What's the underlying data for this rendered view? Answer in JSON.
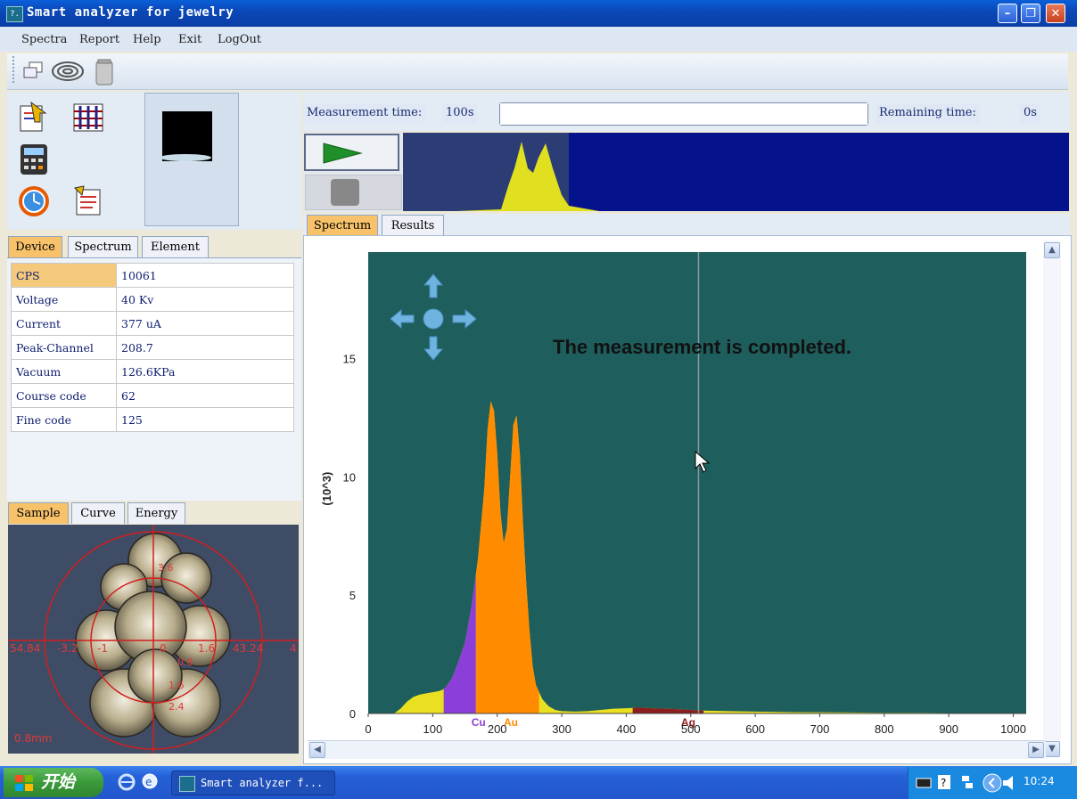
{
  "window": {
    "title": "Smart analyzer for jewelry",
    "icon_text": "?.",
    "controls": [
      "minimize",
      "restore",
      "close"
    ]
  },
  "menu": {
    "items": [
      "Spectra",
      "Report",
      "Help",
      "Exit",
      "LogOut"
    ]
  },
  "toolbar": {
    "icons": [
      "windows-icon",
      "rings-icon",
      "container-icon"
    ]
  },
  "left_icons": [
    "report-doc-icon",
    "grid-chart-icon",
    "calculator-icon",
    "clock-icon",
    "notes-icon"
  ],
  "device_tabs": {
    "labels": [
      "Device",
      "Spectrum",
      "Element"
    ],
    "active": "Device"
  },
  "device_table": [
    {
      "key": "CPS",
      "value": "10061"
    },
    {
      "key": "Voltage",
      "value": "40 Kv"
    },
    {
      "key": "Current",
      "value": "377 uA"
    },
    {
      "key": "Peak-Channel",
      "value": "208.7"
    },
    {
      "key": "Vacuum",
      "value": "126.6KPa"
    },
    {
      "key": "Course code",
      "value": "62"
    },
    {
      "key": "Fine code",
      "value": "125"
    }
  ],
  "sample_tabs": {
    "labels": [
      "Sample",
      "Curve",
      "Energy"
    ],
    "active": "Sample"
  },
  "sample": {
    "scale_label": "0.8mm",
    "axis_labels_h": [
      "54.84",
      "-3.2",
      "-1",
      "0",
      "1.6",
      "43.24",
      "4"
    ],
    "axis_labels_v": [
      "3.6",
      "0.8",
      "1.6",
      "2.4"
    ]
  },
  "measurement": {
    "time_label": "Measurement time:",
    "time_value": "100s",
    "progress": 1.0,
    "remaining_label": "Remaining time:",
    "remaining_value": "0s"
  },
  "chart_tabs": {
    "labels": [
      "Spectrum",
      "Results"
    ],
    "active": "Spectrum"
  },
  "status_message": "The measurement is completed.",
  "chart_data": {
    "type": "area",
    "ylabel": "(10^3)",
    "xlim": [
      0,
      1020
    ],
    "ylim": [
      0,
      19.5
    ],
    "x_ticks": [
      0,
      100,
      200,
      300,
      400,
      500,
      600,
      700,
      800,
      900,
      1000
    ],
    "y_ticks": [
      0,
      5,
      10,
      15
    ],
    "cursor_x": 512,
    "background": "#1e5e5c",
    "x": [
      40,
      50,
      60,
      70,
      80,
      90,
      100,
      110,
      115,
      120,
      130,
      140,
      150,
      160,
      165,
      170,
      180,
      185,
      190,
      195,
      200,
      205,
      210,
      215,
      220,
      225,
      230,
      235,
      240,
      245,
      250,
      255,
      260,
      270,
      280,
      290,
      300,
      320,
      340,
      360,
      380,
      400,
      420,
      440,
      460,
      480,
      500,
      520,
      560,
      600,
      650,
      700,
      750,
      800,
      850,
      900,
      950,
      1000
    ],
    "y": [
      0.0,
      0.2,
      0.5,
      0.7,
      0.8,
      0.85,
      0.9,
      0.95,
      1.0,
      1.1,
      1.5,
      2.2,
      3.0,
      4.5,
      5.5,
      6.5,
      9.5,
      12.0,
      13.2,
      12.8,
      11.0,
      8.5,
      7.2,
      7.8,
      10.0,
      12.2,
      12.6,
      11.0,
      8.0,
      5.5,
      3.5,
      2.0,
      1.2,
      0.6,
      0.3,
      0.15,
      0.1,
      0.08,
      0.1,
      0.15,
      0.2,
      0.22,
      0.25,
      0.22,
      0.2,
      0.18,
      0.15,
      0.12,
      0.1,
      0.08,
      0.06,
      0.05,
      0.04,
      0.03,
      0.03,
      0.02,
      0.01,
      0.0
    ],
    "regions": [
      {
        "name": "Cu",
        "from": 117,
        "to": 167,
        "color": "#8b3fd8",
        "label_x": 160
      },
      {
        "name": "Au",
        "from": 167,
        "to": 265,
        "color": "#ff8c00",
        "label_x": 210
      },
      {
        "name": "Ag",
        "from": 410,
        "to": 520,
        "color": "#8b1e1e",
        "label_x": 485
      }
    ],
    "base_color": "#e8e020"
  },
  "taskbar": {
    "start_label": "开始",
    "task_label": "Smart analyzer f...",
    "clock": "10:24"
  }
}
